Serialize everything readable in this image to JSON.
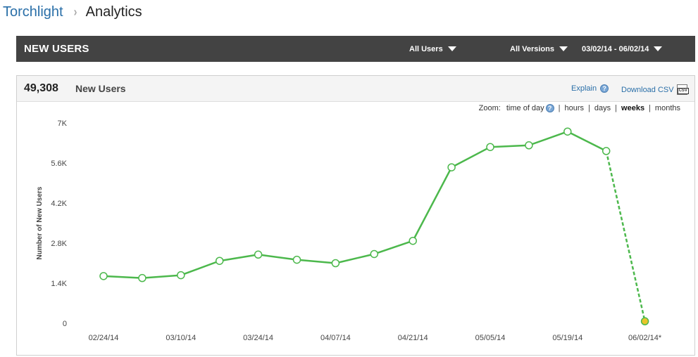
{
  "breadcrumb": {
    "app": "Torchlight",
    "separator": "›",
    "page": "Analytics"
  },
  "header": {
    "title": "NEW USERS",
    "users_filter": "All Users",
    "versions_filter": "All Versions",
    "date_range": "03/02/14 - 06/02/14"
  },
  "summary": {
    "count": "49,308",
    "label": "New Users",
    "explain": "Explain",
    "download": "Download CSV",
    "csv_badge": "CSV"
  },
  "zoom": {
    "label": "Zoom:",
    "options": [
      {
        "label": "time of day",
        "active": false,
        "help": true
      },
      {
        "label": "hours",
        "active": false
      },
      {
        "label": "days",
        "active": false
      },
      {
        "label": "weeks",
        "active": true
      },
      {
        "label": "months",
        "active": false
      }
    ]
  },
  "colors": {
    "line": "#4cb84c",
    "header_bg": "#434343",
    "link": "#2a6fa8",
    "partial_point": "#e8c52a"
  },
  "chart_data": {
    "type": "line",
    "ylabel": "Number of New Users",
    "xlabel": "",
    "ylim": [
      0,
      7000
    ],
    "yticks": [
      "0",
      "1.4K",
      "2.8K",
      "4.2K",
      "5.6K",
      "7K"
    ],
    "ytick_values": [
      0,
      1400,
      2800,
      4200,
      5600,
      7000
    ],
    "xtick_labels": [
      "02/24/14",
      "03/10/14",
      "03/24/14",
      "04/07/14",
      "04/21/14",
      "05/05/14",
      "05/19/14",
      "06/02/14*"
    ],
    "xtick_indices": [
      0,
      2,
      4,
      6,
      8,
      10,
      12,
      14
    ],
    "series": [
      {
        "values": [
          1650,
          1580,
          1680,
          2180,
          2400,
          2220,
          2100,
          2420,
          2880,
          5450,
          6160,
          6220,
          6700,
          6020,
          70
        ]
      }
    ],
    "partial_last_point": true,
    "grid": false
  }
}
